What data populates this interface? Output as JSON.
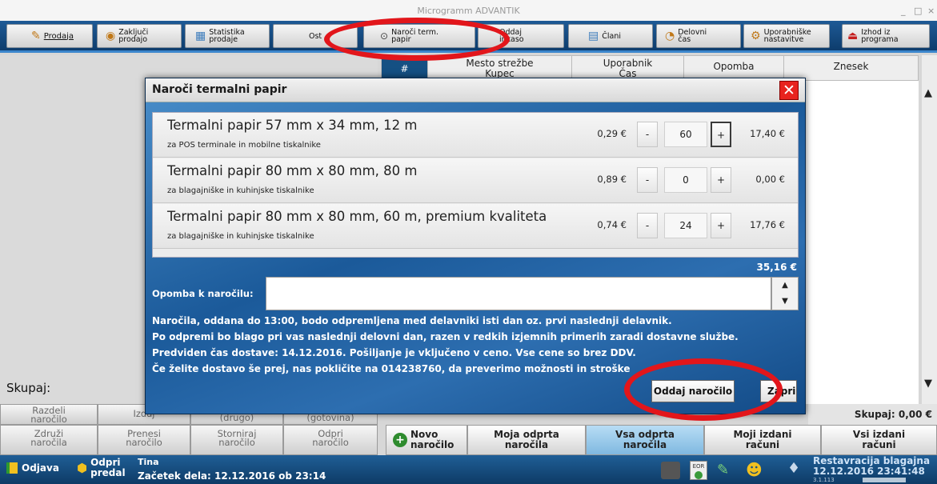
{
  "window": {
    "title": "Microgramm ADVANTIK",
    "minimize": "_",
    "maximize": "□",
    "close": "×"
  },
  "toolbar": {
    "prodaja": "Prodaja",
    "zakljuci_1": "Zaključi",
    "zakljuci_2": "prodajo",
    "statistika_1": "Statistika",
    "statistika_2": "prodaje",
    "ostalo": "Ost",
    "naroci_1": "Naroči term.",
    "naroci_2": "papir",
    "oddaj_1": "Oddaj",
    "oddaj_2": "inkaso",
    "clani": "Člani",
    "delovni_1": "Delovni",
    "delovni_2": "čas",
    "uporabniske_1": "Uporabniške",
    "uporabniske_2": "nastavitve",
    "izhod_1": "Izhod iz",
    "izhod_2": "programa"
  },
  "table": {
    "col_hash": "#",
    "col_mesto_1": "Mesto strežbe",
    "col_mesto_2": "Kupec",
    "col_uporabnik_1": "Uporabnik",
    "col_uporabnik_2": "Čas",
    "col_opomba": "Opomba",
    "col_znesek": "Znesek"
  },
  "left": {
    "skupaj": "Skupaj:"
  },
  "dialog": {
    "title": "Naroči termalni papir",
    "items": [
      {
        "name": "Termalni papir 57 mm x 34 mm, 12 m",
        "desc": "za POS terminale in mobilne tiskalnike",
        "price": "0,29 €",
        "minus": "-",
        "qty": "60",
        "plus": "+",
        "total": "17,40 €"
      },
      {
        "name": "Termalni papir 80 mm x 80 mm, 80 m",
        "desc": "za blagajniške in kuhinjske tiskalnike",
        "price": "0,89 €",
        "minus": "-",
        "qty": "0",
        "plus": "+",
        "total": "0,00 €"
      },
      {
        "name": "Termalni papir 80 mm x 80 mm, 60 m, premium kvaliteta",
        "desc": "za blagajniške in kuhinjske tiskalnike",
        "price": "0,74 €",
        "minus": "-",
        "qty": "24",
        "plus": "+",
        "total": "17,76 €"
      }
    ],
    "grand_total": "35,16 €",
    "note_label": "Opomba k naročilu:",
    "info_1": "Naročila, oddana do 13:00, bodo odpremljena med delavniki isti dan oz. prvi naslednji delavnik.",
    "info_2": "Po odpremi bo blago pri vas naslednji delovni dan, razen v redkih izjemnih primerih zaradi dostavne službe.",
    "info_3": "Predviden čas dostave: 14.12.2016. Pošiljanje je vključeno v ceno. Vse cene so brez DDV.",
    "info_4": "Če želite dostavo še prej, nas pokličite na 014238760, da preverimo možnosti in stroške",
    "submit": "Oddaj naročilo",
    "close": "Zapri"
  },
  "grid_buttons": {
    "razdeli_1": "Razdeli",
    "razdeli_2": "naročilo",
    "izdaj": "Izdaj",
    "drugo": "(drugo)",
    "gotovina": "(gotovina)",
    "zdruzi_1": "Združi",
    "zdruzi_2": "naročila",
    "prenesi_1": "Prenesi",
    "prenesi_2": "naročilo",
    "storniraj_1": "Storniraj",
    "storniraj_2": "naročilo",
    "odpri_1": "Odpri",
    "odpri_2": "naročilo"
  },
  "bottom_buttons": {
    "novo_1": "Novo",
    "novo_2": "naročilo",
    "moja_1": "Moja odprta",
    "moja_2": "naročila",
    "vsa_1": "Vsa odprta",
    "vsa_2": "naročila",
    "mojiizd_1": "Moji izdani",
    "mojiizd_2": "računi",
    "vsiizd_1": "Vsi izdani",
    "vsiizd_2": "računi"
  },
  "sum": "Skupaj: 0,00 €",
  "status": {
    "odjava": "Odjava",
    "odpri_1": "Odpri",
    "odpri_2": "predal",
    "user": "Tina",
    "shift": "Začetek dela: 12.12.2016 ob 23:14",
    "eor": "EOR",
    "company": "Restavracija blagajna",
    "datetime": "12.12.2016 23:41:48",
    "version": "3.1.113"
  },
  "colors": {
    "accent": "#155083",
    "highlight": "#e2161b",
    "dialog_bg": "#1b5a9a"
  }
}
